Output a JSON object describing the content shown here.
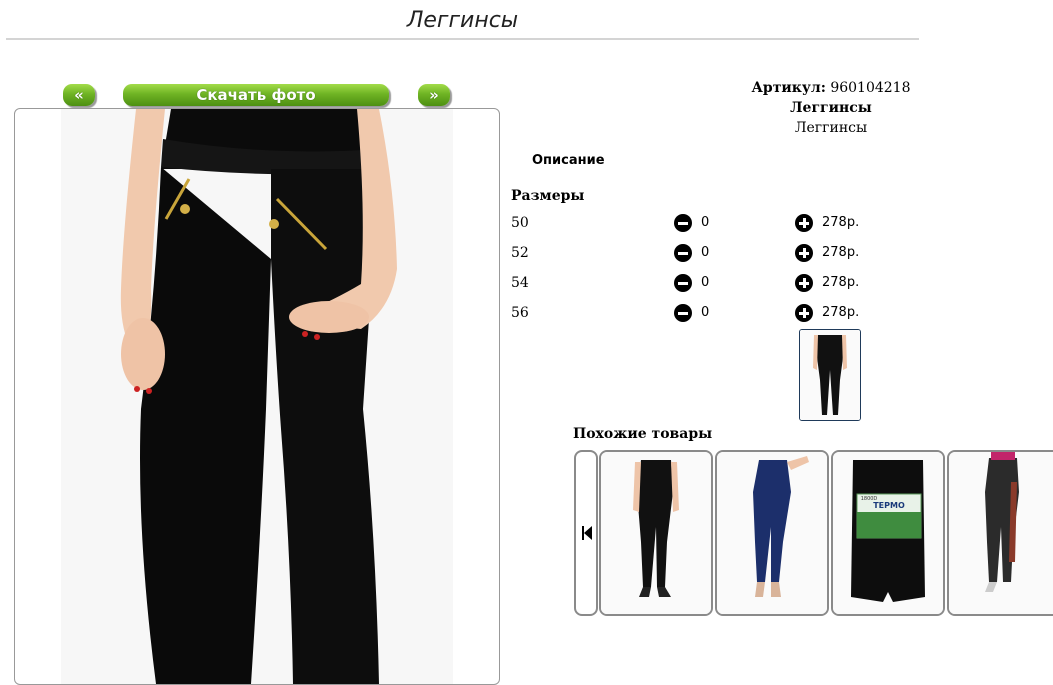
{
  "page": {
    "title": "Леггинсы"
  },
  "gallery": {
    "prev_label": "«",
    "download_label": "Скачать фото",
    "next_label": "»"
  },
  "product": {
    "article_label": "Артикул:",
    "article_value": "960104218",
    "name": "Леггинсы",
    "category": "Леггинсы",
    "description_label": "Описание",
    "sizes_label": "Размеры",
    "sizes": [
      {
        "size": "50",
        "qty": "0",
        "price": "278р."
      },
      {
        "size": "52",
        "qty": "0",
        "price": "278р."
      },
      {
        "size": "54",
        "qty": "0",
        "price": "278р."
      },
      {
        "size": "56",
        "qty": "0",
        "price": "278р."
      }
    ]
  },
  "similar": {
    "title": "Похожие товары",
    "items": [
      {
        "icon": "black-leggings-photo"
      },
      {
        "icon": "blue-jeggings-photo"
      },
      {
        "icon": "thermo-tights-package-photo",
        "pack_brand": "ТЕРМО",
        "pack_den": "1800D"
      },
      {
        "icon": "leather-leggings-photo"
      }
    ]
  }
}
